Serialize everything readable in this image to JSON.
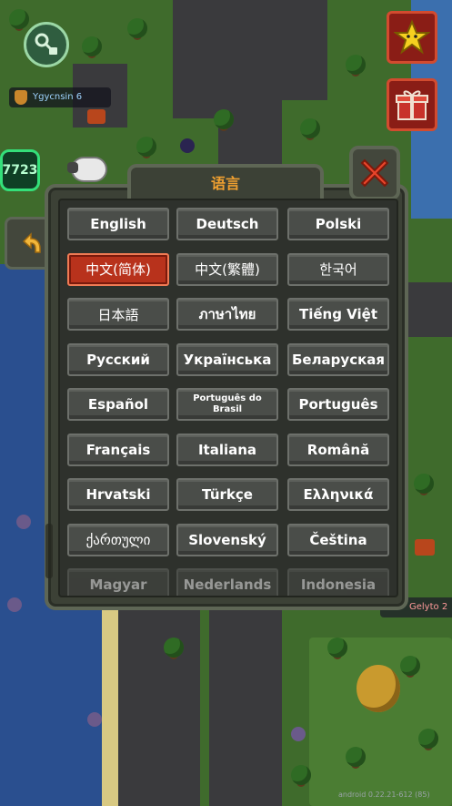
{
  "hud": {
    "player_name": "Ygycnsin",
    "player_level": "6",
    "counter": "7723",
    "other_player_name": "Gelyto",
    "other_player_level": "2",
    "version_text": "android 0.22.21-612 (85)"
  },
  "panel": {
    "title": "语言",
    "languages": [
      {
        "label": "English"
      },
      {
        "label": "Deutsch"
      },
      {
        "label": "Polski"
      },
      {
        "label": "中文(简体)",
        "selected": true
      },
      {
        "label": "中文(繁體)"
      },
      {
        "label": "한국어"
      },
      {
        "label": "日本語"
      },
      {
        "label": "ภาษาไทย"
      },
      {
        "label": "Tiếng Việt"
      },
      {
        "label": "Русский"
      },
      {
        "label": "Українська"
      },
      {
        "label": "Беларуская"
      },
      {
        "label": "Español"
      },
      {
        "label": "Português do Brasil"
      },
      {
        "label": "Português"
      },
      {
        "label": "Français"
      },
      {
        "label": "Italiana"
      },
      {
        "label": "Română"
      },
      {
        "label": "Hrvatski"
      },
      {
        "label": "Türkçe"
      },
      {
        "label": "Ελληνικά"
      },
      {
        "label": "ქართული"
      },
      {
        "label": "Slovenský"
      },
      {
        "label": "Čeština"
      },
      {
        "label": "Magyar"
      },
      {
        "label": "Nederlands"
      },
      {
        "label": "Indonesia"
      }
    ]
  },
  "icons": {
    "key": "key-lock-icon",
    "star": "star-icon",
    "gift": "gift-icon",
    "back": "back-arrow-icon",
    "close": "close-icon"
  },
  "colors": {
    "title": "#f0a030",
    "selected_button": "#b8321c",
    "close_x": "#e8442a",
    "counter_border": "#34e07a"
  }
}
